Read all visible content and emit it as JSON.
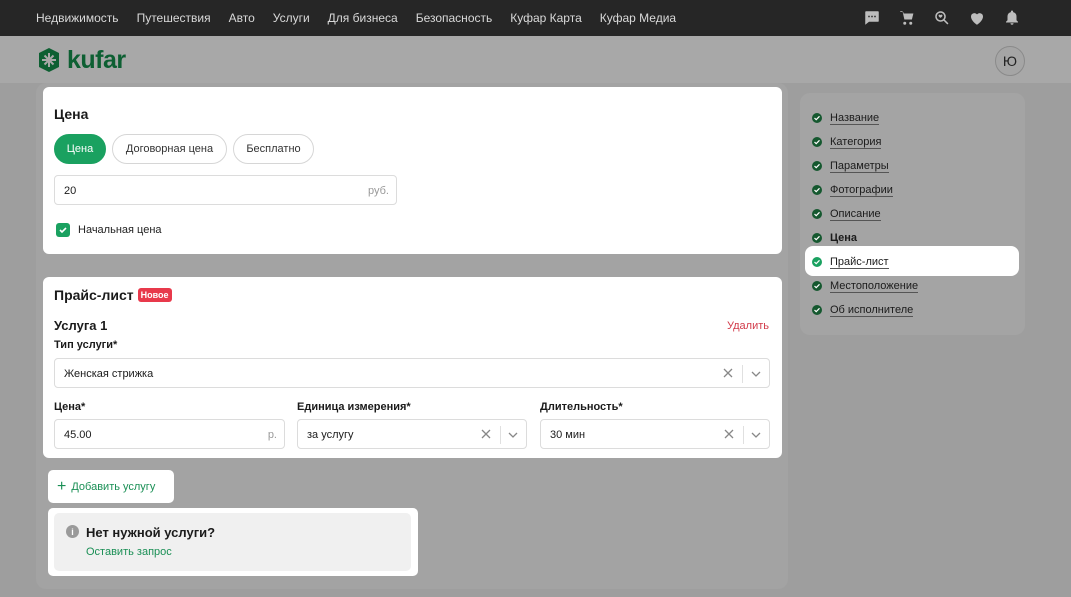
{
  "topnav": {
    "links": [
      "Недвижимость",
      "Путешествия",
      "Авто",
      "Услуги",
      "Для бизнеса",
      "Безопасность",
      "Куфар Карта",
      "Куфар Медиа"
    ],
    "icons": [
      "chat-icon",
      "cart-icon",
      "search-heart-icon",
      "favorites-icon",
      "notifications-icon"
    ]
  },
  "header": {
    "logo_text": "kufar",
    "avatar_letter": "Ю"
  },
  "price": {
    "title": "Цена",
    "options": [
      "Цена",
      "Договорная цена",
      "Бесплатно"
    ],
    "selected": "Цена",
    "value": "20",
    "currency": "руб.",
    "checkbox_label": "Начальная цена"
  },
  "pricelist": {
    "title": "Прайс-лист",
    "badge": "Новое",
    "service_title": "Услуга 1",
    "delete_label": "Удалить",
    "type_label": "Тип услуги*",
    "type_value": "Женская стрижка",
    "price_label": "Цена*",
    "price_value": "45.00",
    "price_suffix": "р.",
    "unit_label": "Единица измерения*",
    "unit_value": "за услугу",
    "duration_label": "Длительность*",
    "duration_value": "30 мин"
  },
  "add_service": {
    "label": "Добавить услугу"
  },
  "no_service": {
    "title": "Нет нужной услуги?",
    "link": "Оставить запрос"
  },
  "sidebar": {
    "items": [
      {
        "label": "Название"
      },
      {
        "label": "Категория"
      },
      {
        "label": "Параметры"
      },
      {
        "label": "Фотографии"
      },
      {
        "label": "Описание"
      },
      {
        "label": "Цена"
      },
      {
        "label": "Прайс-лист"
      },
      {
        "label": "Местоположение"
      },
      {
        "label": "Об исполнителе"
      }
    ]
  },
  "colors": {
    "accent": "#1aa160",
    "danger": "#d23b4a",
    "badge": "#e8394b"
  }
}
